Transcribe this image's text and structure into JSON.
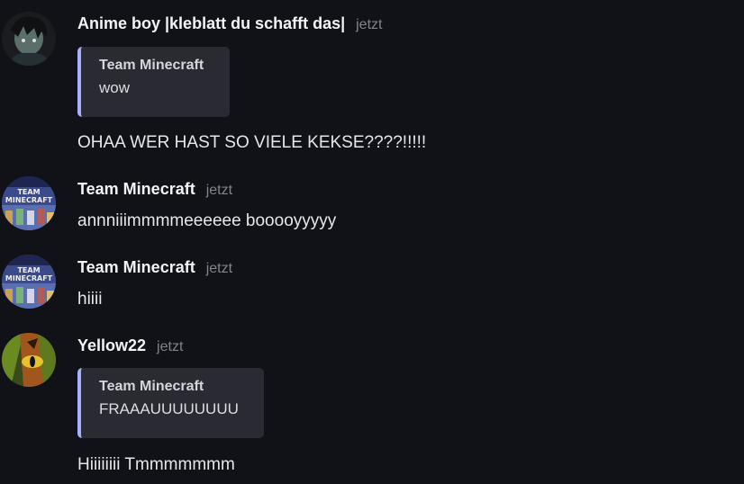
{
  "messages": [
    {
      "username": "Anime boy |kleblatt du schafft das|",
      "timestamp": "jetzt",
      "avatar_icon": "anime-boy-avatar",
      "quote": {
        "author": "Team Minecraft",
        "text": "wow"
      },
      "text": "OHAA WER HAST SO VIELE KEKSE????!!!!!"
    },
    {
      "username": "Team Minecraft",
      "timestamp": "jetzt",
      "avatar_icon": "team-minecraft-avatar",
      "avatar_text": [
        "TEAM",
        "MINECRAFT"
      ],
      "text": "annniiimmmmeeeeee booooyyyyy"
    },
    {
      "username": "Team Minecraft",
      "timestamp": "jetzt",
      "avatar_icon": "team-minecraft-avatar",
      "avatar_text": [
        "TEAM",
        "MINECRAFT"
      ],
      "text": "hiiii"
    },
    {
      "username": "Yellow22",
      "timestamp": "jetzt",
      "avatar_icon": "cat-eye-avatar",
      "quote": {
        "author": "Team Minecraft",
        "text": "FRAAAUUUUUUUU"
      },
      "text": "Hiiiiiiii Tmmmmmmm"
    }
  ],
  "colors": {
    "background": "#111218",
    "username": "#f2f3f5",
    "timestamp": "#80848e",
    "quote_background": "#2a2b32",
    "quote_border": "#a5b1f8"
  }
}
